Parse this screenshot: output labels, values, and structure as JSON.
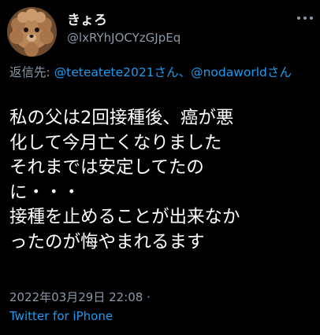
{
  "author": {
    "display_name": "きょろ",
    "handle": "@lxRYhJOCYzGJpEq",
    "avatar_icon": "poodle-avatar"
  },
  "reply": {
    "prefix": "返信先: ",
    "mention_1": "@teteatete2021さん",
    "separator": "、",
    "mention_2": "@nodaworldさん"
  },
  "tweet": {
    "lines": [
      "私の父は2回接種後、癌が悪",
      "化して今月亡くなりました",
      "それまでは安定してたの",
      "に・・・",
      "接種を止めることが出来なか",
      "ったのが悔やまれるます"
    ]
  },
  "meta": {
    "timestamp": "2022年03月29日 22:08 ·",
    "source": "Twitter for iPhone"
  },
  "colors": {
    "background": "#000000",
    "primary_text": "#e7e9ea",
    "secondary_text": "#8b98a5",
    "link": "#1d9bf0"
  },
  "icons": {
    "more": "more-options-icon"
  }
}
